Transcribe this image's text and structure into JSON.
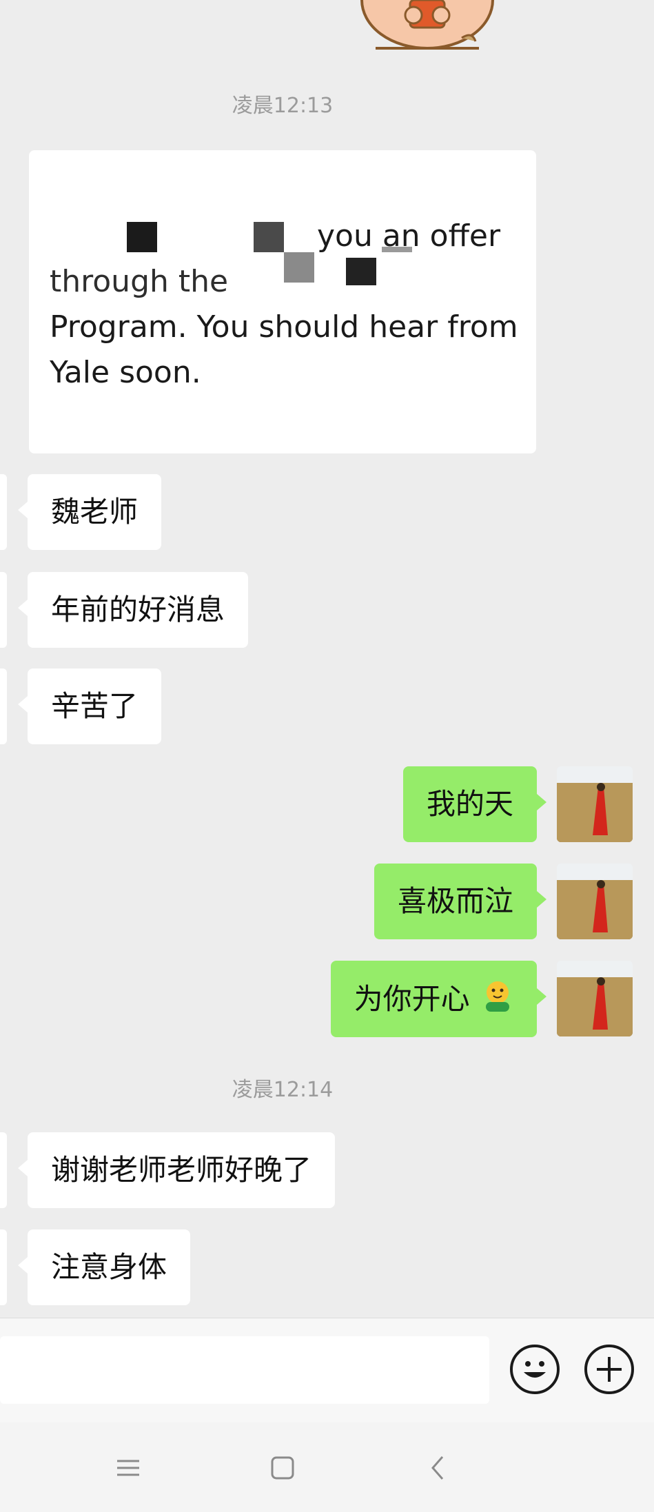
{
  "messages": {
    "timestamp_1": "凌晨12:13",
    "quote": {
      "line1": "you an offer",
      "line2": "through the",
      "line3": "Program. You should hear from",
      "line4": "Yale soon."
    },
    "incoming_1": "魏老师",
    "incoming_2": "年前的好消息",
    "incoming_3": "辛苦了",
    "outgoing_1": "我的天",
    "outgoing_2": "喜极而泣",
    "outgoing_3": "为你开心",
    "timestamp_2": "凌晨12:14",
    "incoming_4": "谢谢老师老师好晚了",
    "incoming_5": "注意身体"
  },
  "input_bar": {
    "placeholder": "",
    "emoji_icon": "smiley-face-icon",
    "plus_icon": "plus-circle-icon"
  },
  "nav": {
    "menu_icon": "menu-icon",
    "home_icon": "home-square-icon",
    "back_icon": "back-chevron-icon"
  },
  "colors": {
    "background": "#ededed",
    "outgoing_bubble": "#95ec69",
    "incoming_bubble": "#ffffff",
    "timestamp": "#9b9b9b"
  }
}
